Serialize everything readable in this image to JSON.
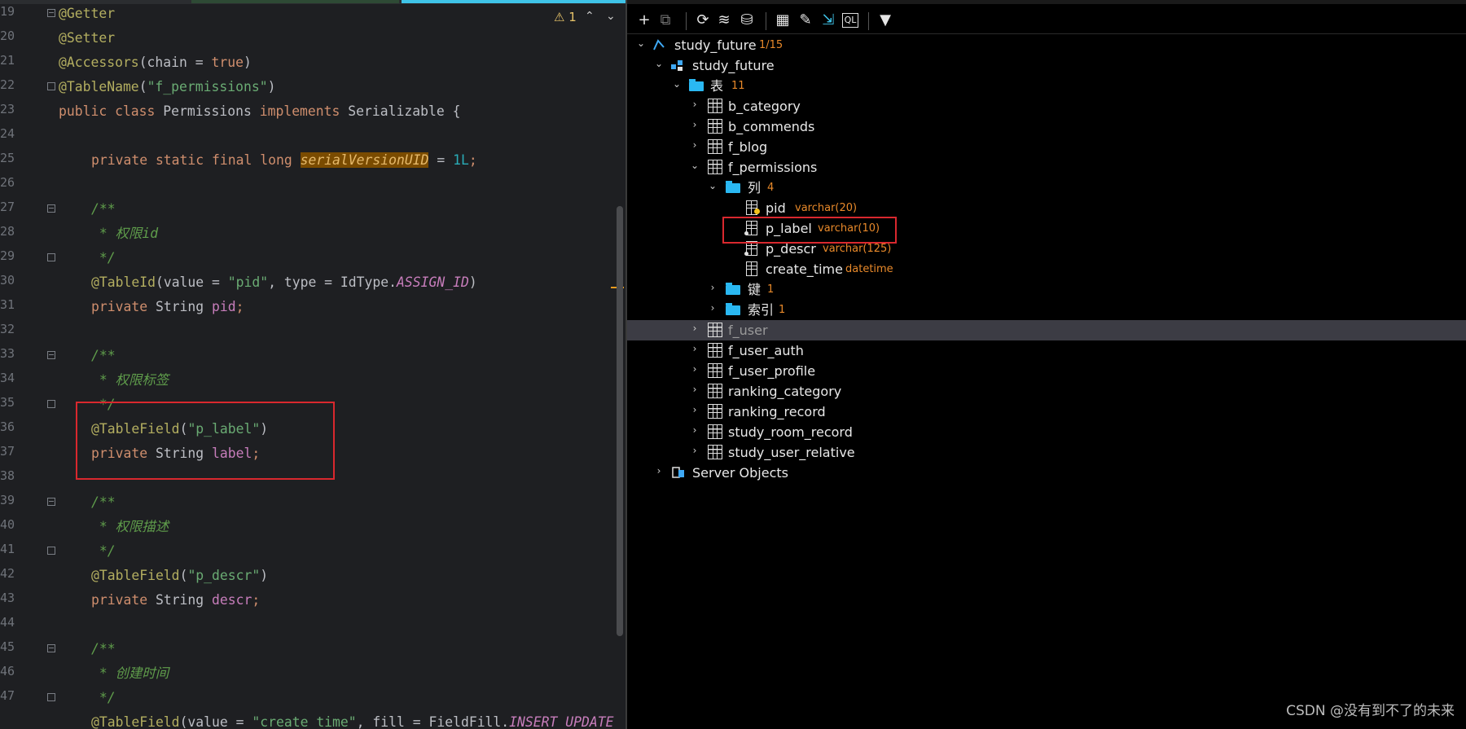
{
  "editor": {
    "warning_count": "1",
    "gutter": [
      "19",
      "20",
      "21",
      "22",
      "23",
      "24",
      "25",
      "26",
      "27",
      "28",
      "29",
      "30",
      "31",
      "32",
      "33",
      "34",
      "35",
      "36",
      "37",
      "38",
      "39",
      "40",
      "41",
      "42",
      "43",
      "44",
      "45",
      "46",
      "47"
    ],
    "lines": {
      "l19": "@Getter",
      "l20": "@Setter",
      "l21_ann": "@Accessors",
      "l21_open": "(chain = ",
      "l21_val": "true",
      "l21_close": ")",
      "l22_ann": "@TableName",
      "l22_open": "(",
      "l22_str": "\"f_permissions\"",
      "l22_close": ")",
      "l23_kw1": "public class ",
      "l23_name": "Permissions ",
      "l23_kw2": "implements ",
      "l23_iface": "Serializable {",
      "l25_kw": "private static final long ",
      "l25_field": "serialVersionUID",
      "l25_eq": " = ",
      "l25_num": "1L",
      "l25_semi": ";",
      "l27": "/**",
      "l28": " * 权限id",
      "l29": " */",
      "l30_ann": "@TableId",
      "l30_open": "(value = ",
      "l30_str": "\"pid\"",
      "l30_mid": ", type = IdType.",
      "l30_const": "ASSIGN_ID",
      "l30_close": ")",
      "l31_kw": "private ",
      "l31_type": "String ",
      "l31_field": "pid",
      "l31_semi": ";",
      "l33": "/**",
      "l34": " * 权限标签",
      "l35": " */",
      "l36_ann": "@TableField",
      "l36_open": "(",
      "l36_str": "\"p_label\"",
      "l36_close": ")",
      "l37_kw": "private ",
      "l37_type": "String ",
      "l37_field": "label",
      "l37_semi": ";",
      "l39": "/**",
      "l40": " * 权限描述",
      "l41": " */",
      "l42_ann": "@TableField",
      "l42_open": "(",
      "l42_str": "\"p_descr\"",
      "l42_close": ")",
      "l43_kw": "private ",
      "l43_type": "String ",
      "l43_field": "descr",
      "l43_semi": ";",
      "l45": "/**",
      "l46": " * 创建时间",
      "l47": " */",
      "l48_ann": "@TableField",
      "l48_open": "(value = ",
      "l48_str": "\"create_time\"",
      "l48_mid": ", fill = FieldFill.",
      "l48_const": "INSERT_UPDATE"
    }
  },
  "toolbar": {
    "icons": [
      "add-icon",
      "copy-icon",
      "refresh-icon",
      "edit-schema-icon",
      "database-icon",
      "table-view-icon",
      "edit-icon",
      "jump-icon",
      "sql-icon",
      "filter-icon"
    ]
  },
  "tree": {
    "connection": {
      "label": "study_future",
      "meta": "1/15"
    },
    "schema": {
      "label": "study_future"
    },
    "tables_folder": {
      "label": "表",
      "meta": "11"
    },
    "tables": [
      "b_category",
      "b_commends",
      "f_blog",
      "f_permissions"
    ],
    "columns_folder": {
      "label": "列",
      "meta": "4"
    },
    "columns": [
      {
        "name": "pid",
        "type": "varchar(20)"
      },
      {
        "name": "p_label",
        "type": "varchar(10)"
      },
      {
        "name": "p_descr",
        "type": "varchar(125)"
      },
      {
        "name": "create_time",
        "type": "datetime"
      }
    ],
    "keys_folder": {
      "label": "键",
      "meta": "1"
    },
    "index_folder": {
      "label": "索引",
      "meta": "1"
    },
    "more_tables": [
      "f_user",
      "f_user_auth",
      "f_user_profile",
      "ranking_category",
      "ranking_record",
      "study_room_record",
      "study_user_relative"
    ],
    "server_objects": "Server Objects"
  },
  "watermark": "CSDN @没有到不了的未来"
}
